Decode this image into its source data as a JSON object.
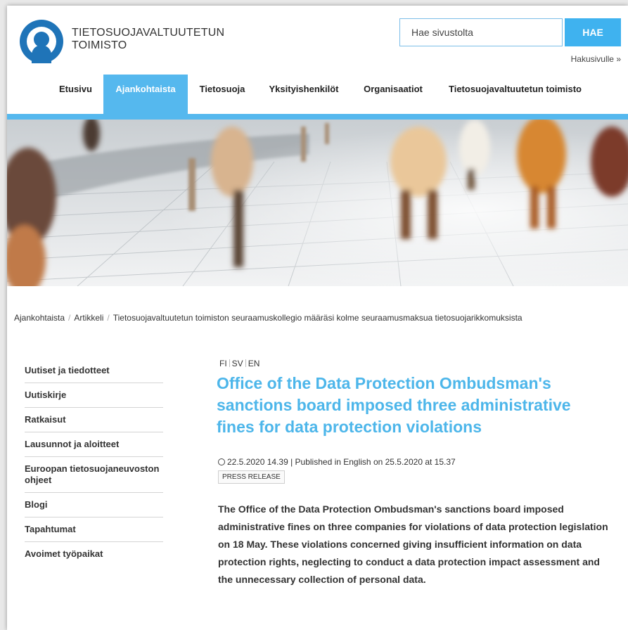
{
  "header": {
    "brand_line1": "TIETOSUOJAVALTUUTETUN",
    "brand_line2": "TOIMISTO",
    "search_placeholder": "Hae sivustolta",
    "search_button": "HAE",
    "advanced_search": "Hakusivulle »"
  },
  "nav": {
    "items": [
      {
        "label": "Etusivu"
      },
      {
        "label": "Ajankohtaista",
        "active": true
      },
      {
        "label": "Tietosuoja"
      },
      {
        "label": "Yksityishenkilöt"
      },
      {
        "label": "Organisaatiot"
      },
      {
        "label": "Tietosuojavaltuutetun toimisto"
      }
    ],
    "accent_color": "#55b8ee"
  },
  "breadcrumb": {
    "items": [
      "Ajankohtaista",
      "Artikkeli",
      "Tietosuojavaltuutetun toimiston seuraamuskollegio määräsi kolme seuraamusmaksua tietosuojarikkomuksista"
    ]
  },
  "sidebar": {
    "items": [
      "Uutiset ja tiedotteet",
      "Uutiskirje",
      "Ratkaisut",
      "Lausunnot ja aloitteet",
      "Euroopan tietosuojaneuvoston ohjeet",
      "Blogi",
      "Tapahtumat",
      "Avoimet työpaikat"
    ]
  },
  "article": {
    "languages": [
      "FI",
      "SV",
      "EN"
    ],
    "title": "Office of the Data Protection Ombudsman's sanctions board imposed three administrative fines for data protection violations",
    "meta": "22.5.2020 14.39 | Published in English on 25.5.2020 at 15.37",
    "badge": "PRESS RELEASE",
    "lead": "The Office of the Data Protection Ombudsman's sanctions board imposed administrative fines on three companies for violations of data protection legislation on 18 May. These violations concerned giving insufficient information on data protection rights, neglecting to conduct a data protection impact assessment and the unnecessary collection of personal data.",
    "title_color": "#4db6ea"
  }
}
